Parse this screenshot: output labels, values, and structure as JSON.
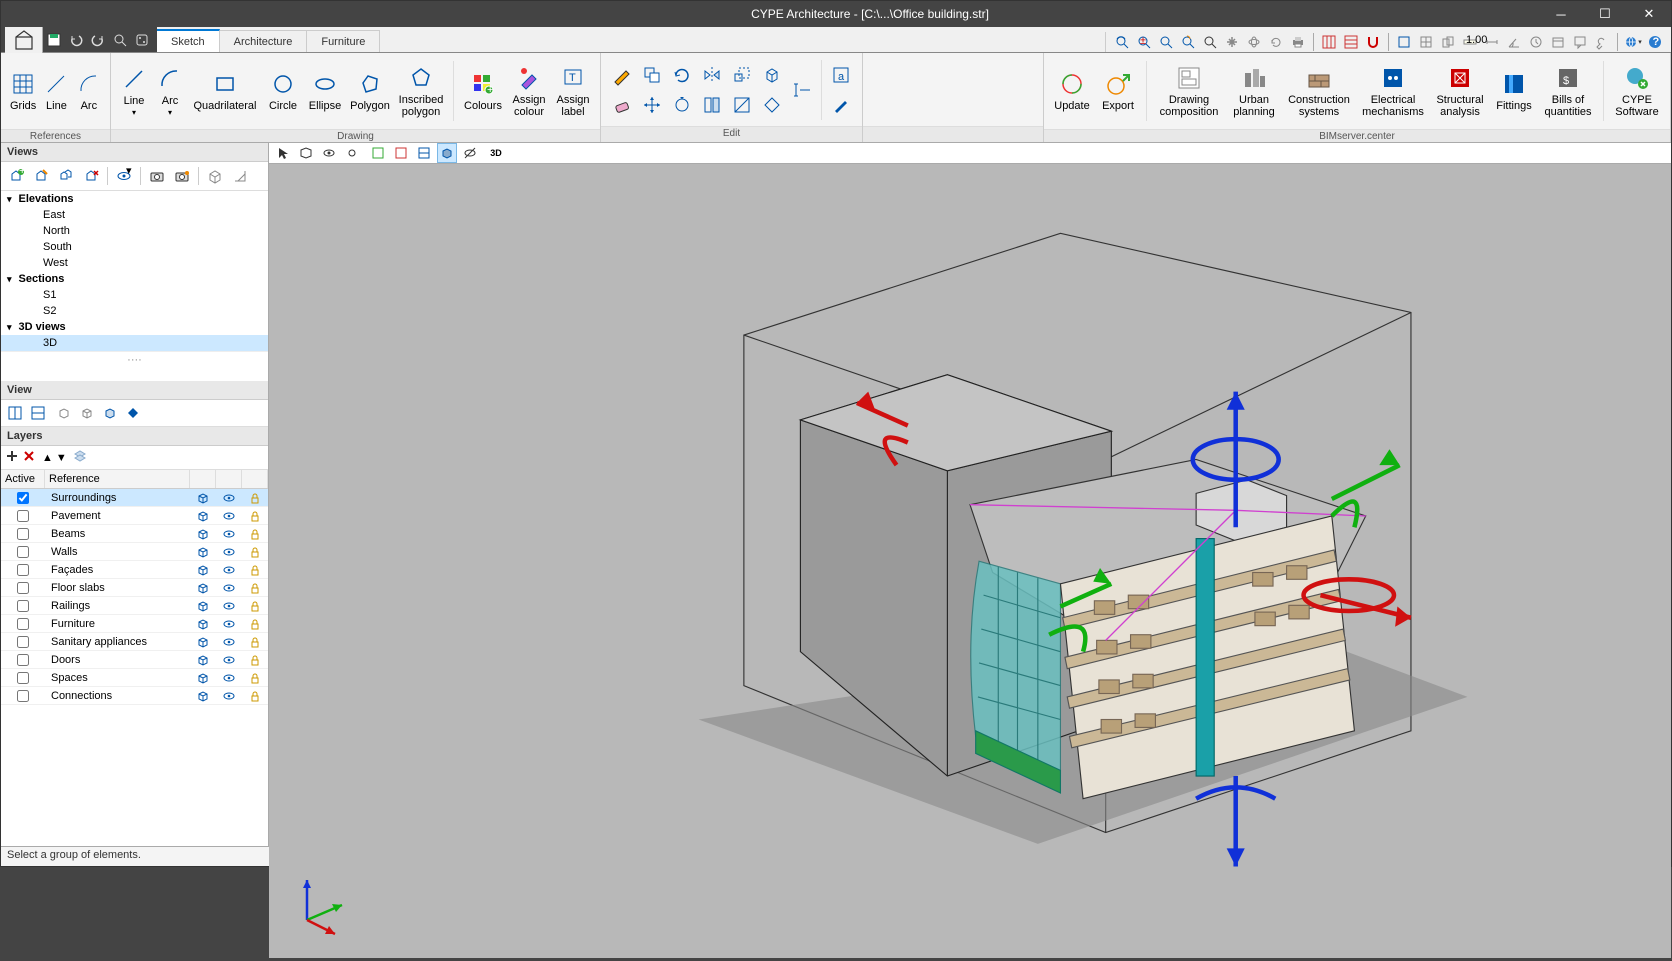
{
  "title": "CYPE Architecture - [C:\\...\\Office building.str]",
  "qat": {
    "save": "save-icon",
    "undo": "undo-icon",
    "redo": "redo-icon",
    "zoom": "magnifier-icon",
    "globe": "globe-icon"
  },
  "tabs": [
    "Sketch",
    "Architecture",
    "Furniture"
  ],
  "activeTab": 0,
  "ribbon": {
    "references": {
      "label": "References",
      "grids": "Grids",
      "line": "Line",
      "arc": "Arc"
    },
    "drawing": {
      "label": "Drawing",
      "line": "Line",
      "arc": "Arc",
      "quad": "Quadrilateral",
      "circle": "Circle",
      "ellipse": "Ellipse",
      "polygon": "Polygon",
      "inscribed": "Inscribed\npolygon",
      "colours": "Colours",
      "assign_colour": "Assign\ncolour",
      "assign_label": "Assign\nlabel"
    },
    "edit": {
      "label": "Edit"
    },
    "bim": {
      "label": "BIMserver.center",
      "update": "Update",
      "export": "Export",
      "drawing_comp": "Drawing\ncomposition",
      "urban": "Urban\nplanning",
      "construction": "Construction\nsystems",
      "electrical": "Electrical\nmechanisms",
      "structural": "Structural\nanalysis",
      "fittings": "Fittings",
      "bills": "Bills of\nquantities",
      "cype": "CYPE\nSoftware"
    }
  },
  "views_panel": {
    "title": "Views",
    "groups": [
      {
        "name": "Elevations",
        "items": [
          "East",
          "North",
          "South",
          "West"
        ]
      },
      {
        "name": "Sections",
        "items": [
          "S1",
          "S2"
        ]
      },
      {
        "name": "3D views",
        "items": [
          "3D"
        ],
        "selected": 0
      }
    ]
  },
  "view_panel": {
    "title": "View"
  },
  "layers_panel": {
    "title": "Layers",
    "headers": {
      "active": "Active",
      "reference": "Reference"
    },
    "rows": [
      {
        "active": true,
        "ref": "Surroundings",
        "selected": true
      },
      {
        "active": false,
        "ref": "Pavement"
      },
      {
        "active": false,
        "ref": "Beams"
      },
      {
        "active": false,
        "ref": "Walls"
      },
      {
        "active": false,
        "ref": "Façades"
      },
      {
        "active": false,
        "ref": "Floor slabs"
      },
      {
        "active": false,
        "ref": "Railings"
      },
      {
        "active": false,
        "ref": "Furniture"
      },
      {
        "active": false,
        "ref": "Sanitary appliances"
      },
      {
        "active": false,
        "ref": "Doors"
      },
      {
        "active": false,
        "ref": "Spaces"
      },
      {
        "active": false,
        "ref": "Connections"
      }
    ]
  },
  "status": "Select a group of elements."
}
